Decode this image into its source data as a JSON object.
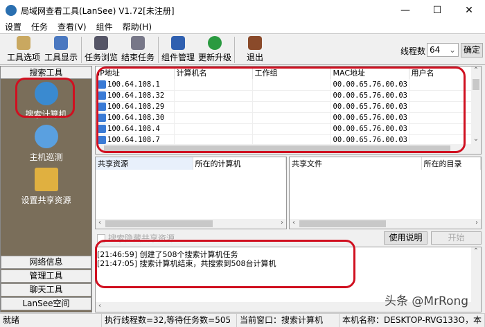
{
  "window": {
    "title": "局域网查看工具(LanSee) V1.72[未注册]"
  },
  "menu": [
    "设置",
    "任务",
    "查看(V)",
    "组件",
    "帮助(H)"
  ],
  "toolbar": {
    "buttons": [
      "工具选项",
      "工具显示",
      "任务浏览",
      "结束任务",
      "组件管理",
      "更新升级",
      "退出"
    ],
    "threads_label": "线程数",
    "threads_value": "64",
    "ok_label": "确定"
  },
  "left": {
    "header": "搜索工具",
    "items": [
      "搜索计算机",
      "主机巡测",
      "设置共享资源"
    ],
    "bottom": [
      "网络信息",
      "管理工具",
      "聊天工具",
      "LanSee空间"
    ]
  },
  "hosts": {
    "columns": [
      "IP地址",
      "计算机名",
      "工作组",
      "MAC地址",
      "用户名"
    ],
    "rows": [
      [
        "100.64.108.1",
        "",
        "",
        "00.00.65.76.00.03",
        ""
      ],
      [
        "100.64.108.32",
        "",
        "",
        "00.00.65.76.00.03",
        ""
      ],
      [
        "100.64.108.29",
        "",
        "",
        "00.00.65.76.00.03",
        ""
      ],
      [
        "100.64.108.30",
        "",
        "",
        "00.00.65.76.00.03",
        ""
      ],
      [
        "100.64.108.4",
        "",
        "",
        "00.00.65.76.00.03",
        ""
      ],
      [
        "100.64.108.7",
        "",
        "",
        "00.00.65.76.00.03",
        ""
      ]
    ]
  },
  "shares": {
    "columns": [
      "共享资源",
      "所在的计算机"
    ]
  },
  "files": {
    "columns": [
      "共享文件",
      "所在的目录"
    ]
  },
  "options": {
    "hidden_share_checkbox": "搜索隐藏共享资源",
    "help_button": "使用说明",
    "start_button": "开始"
  },
  "log": [
    "[21:46:59] 创建了508个搜索计算机任务",
    "[21:47:05] 搜索计算机结束，共搜索到508台计算机"
  ],
  "status": {
    "ready": "就绪",
    "threads": "执行线程数=32,等待任务数=505",
    "current": "当前窗口：搜索计算机",
    "host": "本机名称：DESKTOP-RVG133O，本"
  },
  "watermark": "头条 @MrRong"
}
